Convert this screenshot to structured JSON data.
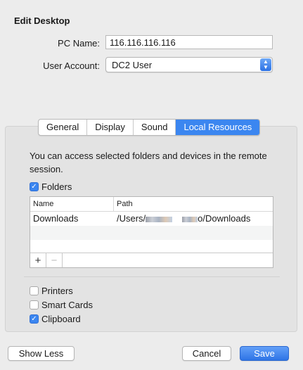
{
  "dialog": {
    "title": "Edit Desktop"
  },
  "form": {
    "pc_name_label": "PC Name:",
    "pc_name_value": "116.116.116.116",
    "user_account_label": "User Account:",
    "user_account_value": "DC2 User"
  },
  "tabs": [
    {
      "label": "General",
      "selected": false
    },
    {
      "label": "Display",
      "selected": false
    },
    {
      "label": "Sound",
      "selected": false
    },
    {
      "label": "Local Resources",
      "selected": true
    }
  ],
  "local_resources": {
    "description": "You can access selected folders and devices in the remote session.",
    "folders_label": "Folders",
    "folders_checked": true,
    "table": {
      "columns": [
        "Name",
        "Path"
      ],
      "rows": [
        {
          "name": "Downloads",
          "path_prefix": "/Users/",
          "path_suffix": "o/Downloads"
        }
      ]
    },
    "add_symbol": "+",
    "remove_symbol": "−",
    "devices": [
      {
        "label": "Printers",
        "checked": false
      },
      {
        "label": "Smart Cards",
        "checked": false
      },
      {
        "label": "Clipboard",
        "checked": true
      }
    ]
  },
  "buttons": {
    "show_less": "Show Less",
    "cancel": "Cancel",
    "save": "Save"
  },
  "colors": {
    "accent": "#3b86f0"
  }
}
